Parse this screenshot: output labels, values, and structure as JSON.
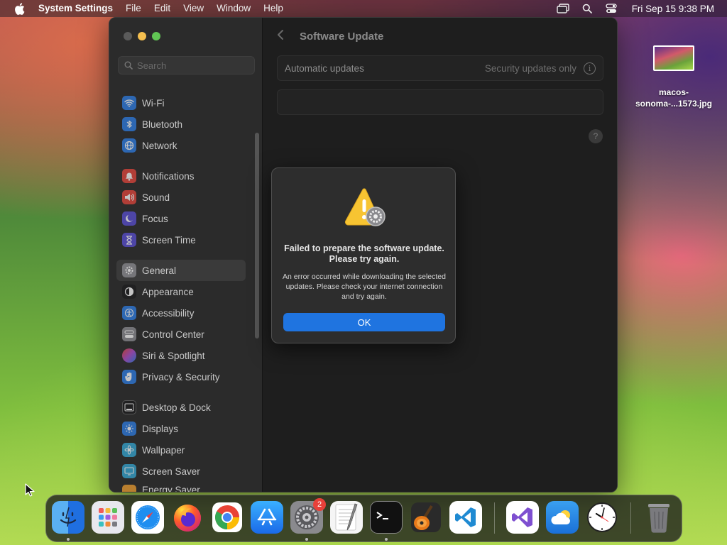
{
  "menubar": {
    "app_name": "System Settings",
    "menus": [
      "File",
      "Edit",
      "View",
      "Window",
      "Help"
    ],
    "clock": "Fri Sep 15  9:38 PM"
  },
  "window": {
    "search": {
      "placeholder": "Search"
    },
    "sidebar": {
      "groups": [
        [
          {
            "label": "Wi-Fi",
            "icon": "wifi-icon",
            "color": "#2f7fe6"
          },
          {
            "label": "Bluetooth",
            "icon": "bluetooth-icon",
            "color": "#2f7fe6"
          },
          {
            "label": "Network",
            "icon": "globe-icon",
            "color": "#2f7fe6"
          }
        ],
        [
          {
            "label": "Notifications",
            "icon": "bell-icon",
            "color": "#e5463c"
          },
          {
            "label": "Sound",
            "icon": "speaker-icon",
            "color": "#e5463c"
          },
          {
            "label": "Focus",
            "icon": "moon-icon",
            "color": "#5b4fd6"
          },
          {
            "label": "Screen Time",
            "icon": "hourglass-icon",
            "color": "#5b4fd6"
          }
        ],
        [
          {
            "label": "General",
            "icon": "gear-icon",
            "color": "#8e8e93",
            "selected": true
          },
          {
            "label": "Appearance",
            "icon": "appearance-icon",
            "color": "#1c1c1e"
          },
          {
            "label": "Accessibility",
            "icon": "accessibility-icon",
            "color": "#2f7fe6"
          },
          {
            "label": "Control Center",
            "icon": "control-center-icon",
            "color": "#8e8e93"
          },
          {
            "label": "Siri & Spotlight",
            "icon": "siri-icon",
            "color": "#b04fd0"
          },
          {
            "label": "Privacy & Security",
            "icon": "hand-icon",
            "color": "#2f7fe6"
          }
        ],
        [
          {
            "label": "Desktop & Dock",
            "icon": "dock-icon",
            "color": "#1c1c1e"
          },
          {
            "label": "Displays",
            "icon": "display-icon",
            "color": "#2f7fe6"
          },
          {
            "label": "Wallpaper",
            "icon": "wallpaper-icon",
            "color": "#35a9d6"
          },
          {
            "label": "Screen Saver",
            "icon": "screen-saver-icon",
            "color": "#35a9d6"
          },
          {
            "label": "Energy Saver",
            "icon": "battery-icon",
            "color": "#f0a030"
          }
        ]
      ]
    },
    "content": {
      "title": "Software Update",
      "auto_updates_label": "Automatic updates",
      "auto_updates_value": "Security updates only",
      "help_glyph": "?"
    }
  },
  "alert": {
    "title": "Failed to prepare the software update. Please try again.",
    "message": "An error occurred while downloading the selected updates. Please check your internet connection and try again.",
    "ok_label": "OK"
  },
  "desktop": {
    "file_name": "macos-sonoma-...1573.jpg"
  },
  "dock": {
    "settings_badge": "2",
    "apps": [
      "Finder",
      "Launchpad",
      "Safari",
      "Firefox",
      "Chrome",
      "App Store",
      "System Settings",
      "TextEdit",
      "Terminal",
      "GarageBand",
      "Visual Studio Code",
      "Visual Studio",
      "Weather",
      "Clock",
      "Trash"
    ]
  }
}
